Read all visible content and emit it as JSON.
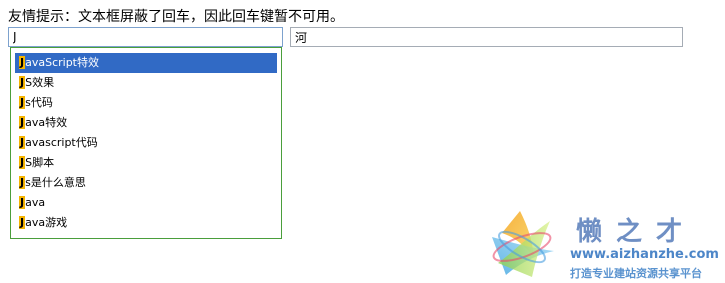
{
  "tip": "友情提示：文本框屏蔽了回车，因此回车键暂不可用。",
  "search": {
    "value": "J"
  },
  "second_input": {
    "value": "河"
  },
  "suggestions": [
    {
      "prefix": "J",
      "rest": "avaScript特效"
    },
    {
      "prefix": "J",
      "rest": "S效果"
    },
    {
      "prefix": "J",
      "rest": "s代码"
    },
    {
      "prefix": "J",
      "rest": "ava特效"
    },
    {
      "prefix": "J",
      "rest": "avascript代码"
    },
    {
      "prefix": "J",
      "rest": "S脚本"
    },
    {
      "prefix": "J",
      "rest": "s是什么意思"
    },
    {
      "prefix": "J",
      "rest": "ava"
    },
    {
      "prefix": "J",
      "rest": "ava游戏"
    }
  ],
  "active_index": 0,
  "colors": {
    "highlight_bg": "#316ac5",
    "match_bg": "#f5b400",
    "dropdown_border": "#4a9e3b"
  },
  "watermark": {
    "title": "懒之才",
    "url": "www.aizhanzhe.com",
    "slogan": "打造专业建站资源共享平台"
  }
}
